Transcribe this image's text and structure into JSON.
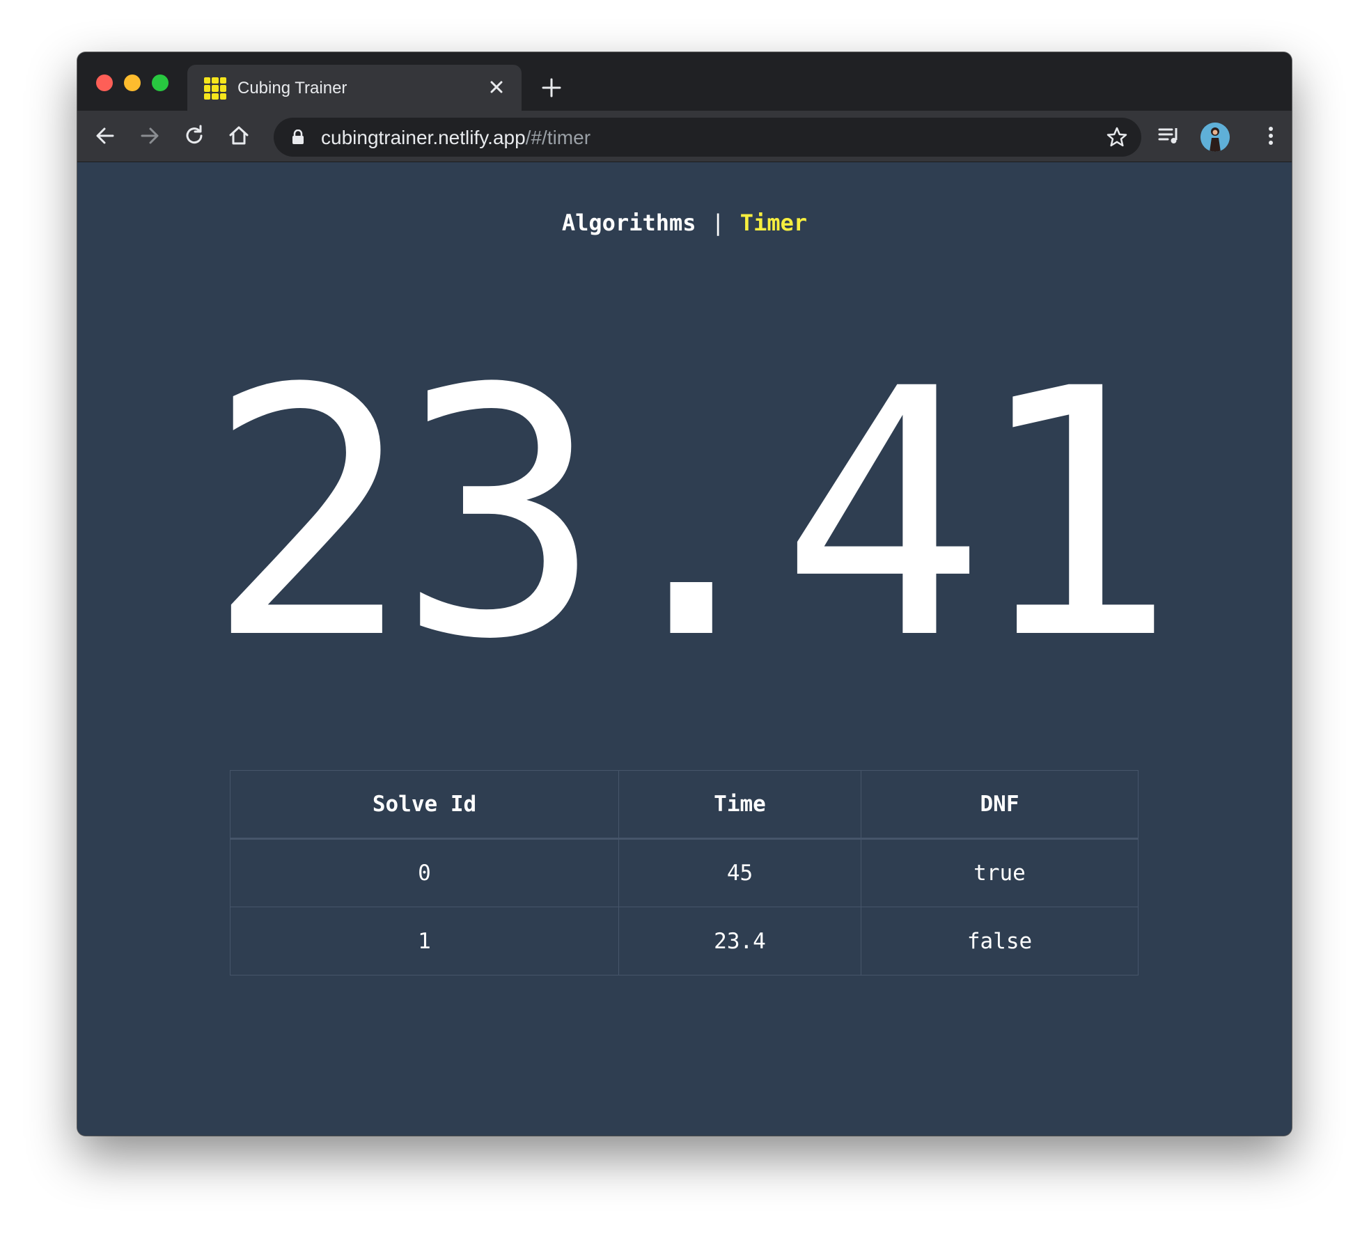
{
  "browser": {
    "tab_title": "Cubing Trainer",
    "url_host": "cubingtrainer.netlify.app",
    "url_path": "/#/timer"
  },
  "nav": {
    "algorithms_label": "Algorithms",
    "separator": "|",
    "timer_label": "Timer"
  },
  "timer": {
    "display": "23.41"
  },
  "solves_table": {
    "headers": [
      "Solve Id",
      "Time",
      "DNF"
    ],
    "rows": [
      [
        "0",
        "45",
        "true"
      ],
      [
        "1",
        "23.4",
        "false"
      ]
    ]
  },
  "colors": {
    "page_background": "#2f3e51",
    "active_nav": "#f6ee3f",
    "text": "#ffffff"
  }
}
